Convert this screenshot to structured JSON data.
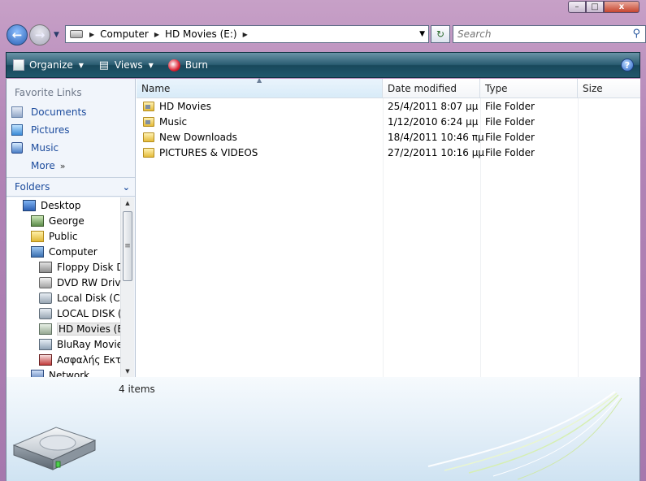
{
  "window": {
    "controls": {
      "minimize": "–",
      "maximize": "□",
      "close": "x"
    }
  },
  "nav": {
    "back_icon": "back-arrow-icon",
    "forward_icon": "forward-arrow-icon",
    "address": {
      "crumbs": [
        "Computer",
        "HD Movies (E:)"
      ]
    },
    "search_placeholder": "Search"
  },
  "toolbar": {
    "organize": "Organize",
    "views": "Views",
    "burn": "Burn",
    "help": "?"
  },
  "sidebar": {
    "favorite_links_title": "Favorite Links",
    "links": [
      {
        "label": "Documents",
        "icon": "documents-icon"
      },
      {
        "label": "Pictures",
        "icon": "pictures-icon"
      },
      {
        "label": "Music",
        "icon": "music-icon"
      }
    ],
    "more": "More",
    "folders_title": "Folders",
    "tree": [
      {
        "label": "Desktop",
        "icon": "desktop-icon"
      },
      {
        "label": "George",
        "icon": "user-folder-icon"
      },
      {
        "label": "Public",
        "icon": "folder-icon"
      },
      {
        "label": "Computer",
        "icon": "computer-icon"
      },
      {
        "label": "Floppy Disk Drive (A:)",
        "icon": "floppy-icon"
      },
      {
        "label": "DVD RW Drive (D:)",
        "icon": "dvd-drive-icon"
      },
      {
        "label": "Local Disk (C:)",
        "icon": "local-disk-icon"
      },
      {
        "label": "LOCAL DISK (D:)",
        "icon": "disk-icon"
      },
      {
        "label": "HD Movies (E:)",
        "icon": "hd-drive-icon",
        "selected": true
      },
      {
        "label": "BluRay Movies",
        "icon": "bluray-drive-icon"
      },
      {
        "label": "Ασφαλής Εκτέλεση",
        "icon": "safe-icon"
      },
      {
        "label": "Network",
        "icon": "network-icon"
      }
    ]
  },
  "list": {
    "columns": [
      "Name",
      "Date modified",
      "Type",
      "Size"
    ],
    "rows": [
      {
        "name": "HD Movies",
        "date": "25/4/2011 8:07 μμ",
        "type": "File Folder",
        "size": ""
      },
      {
        "name": "Music",
        "date": "1/12/2010 6:24 μμ",
        "type": "File Folder",
        "size": ""
      },
      {
        "name": "New Downloads",
        "date": "18/4/2011 10:46 πμ",
        "type": "File Folder",
        "size": ""
      },
      {
        "name": "PICTURES & VIDEOS",
        "date": "27/2/2011 10:16 μμ",
        "type": "File Folder",
        "size": ""
      }
    ]
  },
  "details": {
    "count": "4 items"
  },
  "colors": {
    "toolbar": "#21576c",
    "link": "#1a4a9c",
    "frame": "#b284b6"
  }
}
